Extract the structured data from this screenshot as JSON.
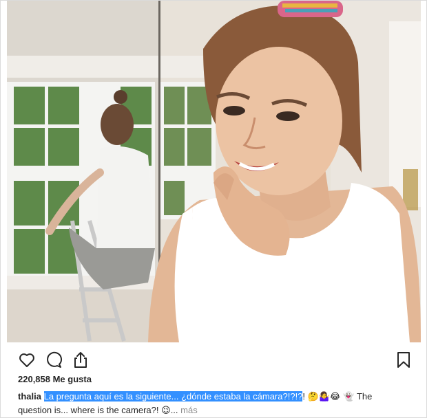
{
  "post": {
    "likes_text": "220,858 Me gusta",
    "username": "thalia",
    "caption_highlighted": "La pregunta aquí es la siguiente... ¿dónde estaba la cámara?!?!?",
    "caption_punct": "!",
    "caption_emojis": "🤔🤷‍♀️😂 👻",
    "caption_rest_a": "The",
    "caption_rest_b": "question is... where is the camera?!",
    "caption_emoji_end": "😉",
    "ellipsis": "...",
    "more_label": "más"
  },
  "icons": {
    "like": "heart-icon",
    "comment": "comment-icon",
    "share": "share-icon",
    "save": "bookmark-icon"
  },
  "colors": {
    "highlight": "#3390ff",
    "text": "#262626",
    "muted": "#8e8e8e"
  }
}
